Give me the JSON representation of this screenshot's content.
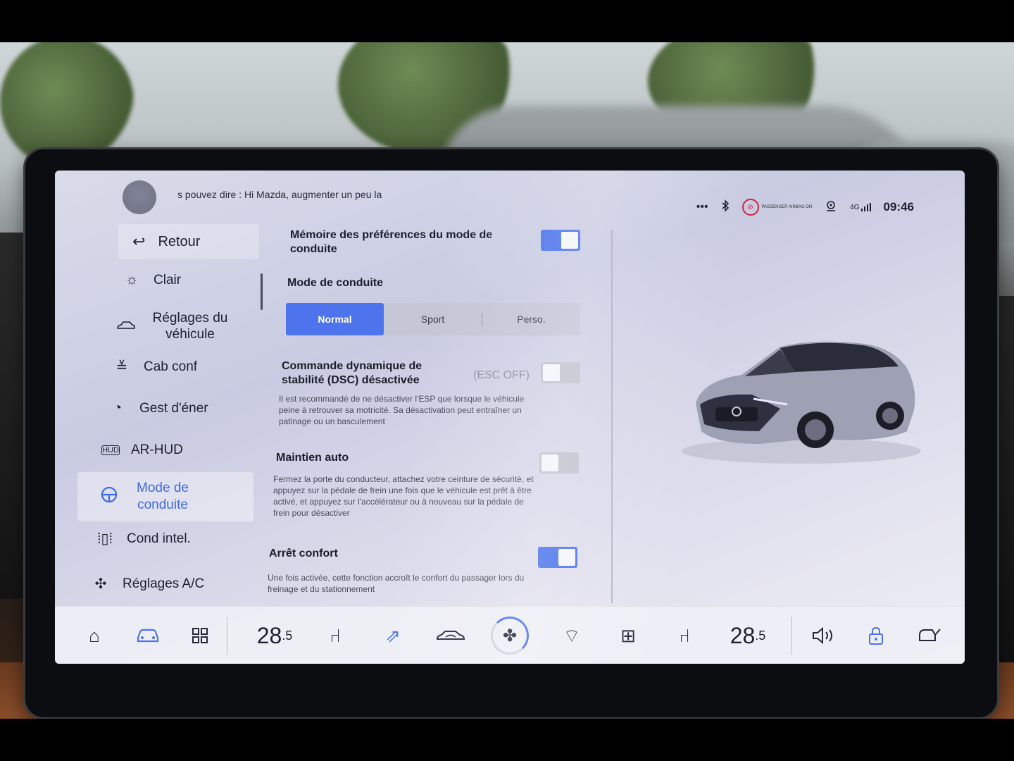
{
  "status": {
    "voice_hint": "s pouvez dire : Hi Mazda, augmenter un peu la",
    "more_label": "•••",
    "bluetooth_icon": "bluetooth-icon",
    "airbag_label": "PASSENGER AIRBAG ON",
    "location_icon": "location-icon",
    "signal_label": "4G",
    "time": "09:46"
  },
  "nav": {
    "back_label": "Retour",
    "items": [
      {
        "label": "Clair",
        "icon": "sun-icon"
      },
      {
        "label": "Réglages du véhicule",
        "icon": "car-icon"
      },
      {
        "label": "Cab conf",
        "icon": "cabin-icon"
      },
      {
        "label": "Gest d'éner",
        "icon": "energy-icon"
      },
      {
        "label": "AR-HUD",
        "icon": "hud-icon"
      },
      {
        "label": "Mode de conduite",
        "icon": "steering-icon"
      },
      {
        "label": "Cond intel.",
        "icon": "lane-icon"
      },
      {
        "label": "Réglages A/C",
        "icon": "fan-icon"
      }
    ]
  },
  "settings": {
    "memory": {
      "title": "Mémoire des préférences du mode de conduite",
      "on": true
    },
    "drive_mode": {
      "title": "Mode de conduite",
      "options": [
        "Normal",
        "Sport",
        "Perso."
      ],
      "selected": "Normal"
    },
    "dsc": {
      "title": "Commande dynamique de stabilité (DSC) désactivée",
      "status": "(ESC OFF)",
      "desc": "Il est recommandé de ne désactiver l'ESP que lorsque le véhicule peine à retrouver sa motricité. Sa désactivation peut entraîner un patinage ou un basculement",
      "on": false
    },
    "auto_hold": {
      "title": "Maintien auto",
      "desc": "Fermez la porte du conducteur, attachez votre ceinture de sécurité, et appuyez sur la pédale de frein une fois que le véhicule est prêt à être activé, et appuyez sur l'accélérateur ou à nouveau sur la pédale de frein pour désactiver",
      "on": false
    },
    "comfort_stop": {
      "title": "Arrêt confort",
      "desc": "Une fois activée, cette fonction accroît le confort du passager lors du freinage et du stationnement",
      "on": true
    }
  },
  "dock": {
    "temp_left_int": "28",
    "temp_left_dec": ".5",
    "temp_right_int": "28",
    "temp_right_dec": ".5",
    "icons": [
      "home-icon",
      "car-icon",
      "apps-grid-icon",
      "seat-heat-left-icon",
      "airflow-icon",
      "car-recirc-icon",
      "fan-icon",
      "front-defrost-icon",
      "rear-defrost-icon",
      "seat-heat-right-icon",
      "volume-icon",
      "lock-icon",
      "car-door-icon"
    ]
  },
  "colors": {
    "accent": "#4d74ec",
    "text": "#1b1d2a",
    "airbag": "#d0243a"
  }
}
